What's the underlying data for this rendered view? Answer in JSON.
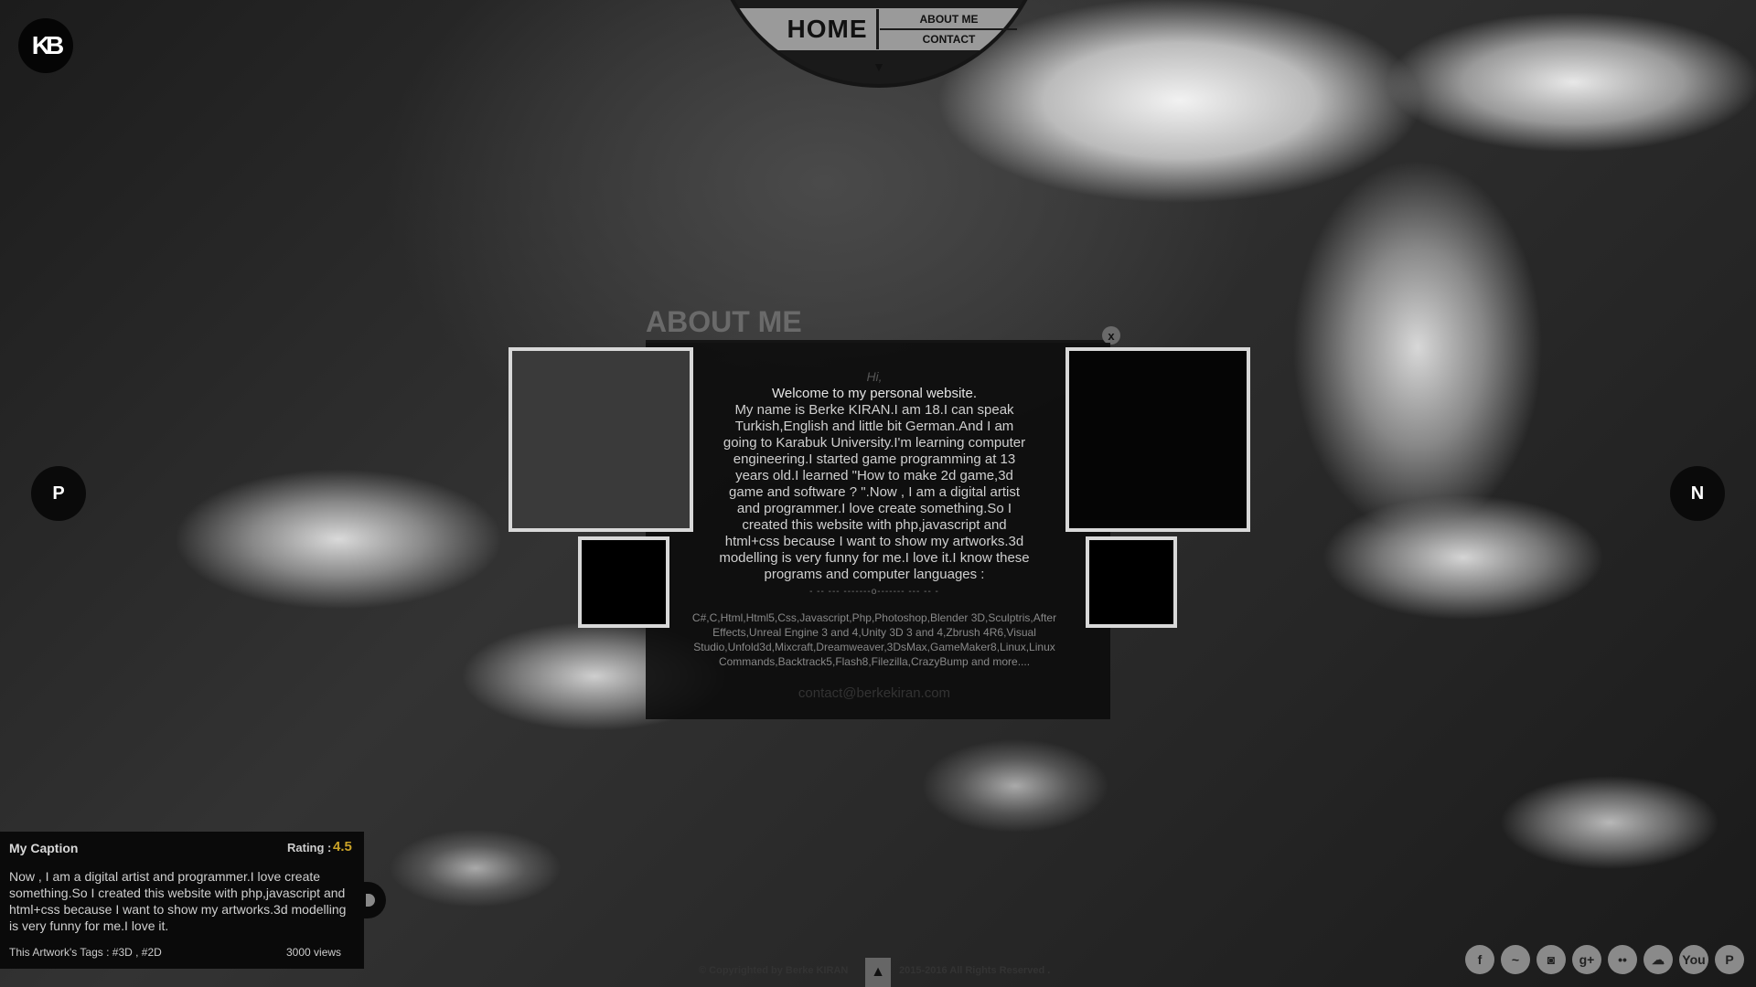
{
  "logo": {
    "text": "KB"
  },
  "nav": {
    "home": "HOME",
    "about": "ABOUT ME",
    "contact": "CONTACT",
    "arrow": "▼"
  },
  "pager": {
    "prev": "P",
    "next": "N"
  },
  "about": {
    "title": "ABOUT ME",
    "close": "x",
    "greeting": "Hi,",
    "welcome": "Welcome to my personal website.",
    "bio": "My name is Berke KIRAN.I am 18.I can speak Turkish,English and little bit German.And I am going to Karabuk University.I'm learning computer engineering.I started game programming at 13 years old.I learned \"How to make 2d game,3d game and software ? \".Now , I am a digital artist and programmer.I love create something.So I created this website with php,javascript and html+css because I want to show my artworks.3d modelling is very funny for me.I love it.I know these programs and computer languages :",
    "separator": "- -- --- -------o------- --- -- -",
    "languages": "C#,C,Html,Html5,Css,Javascript,Php,Photoshop,Blender 3D,Sculptris,After Effects,Unreal Engine 3 and 4,Unity 3D 3 and 4,Zbrush 4R6,Visual Studio,Unfold3d,Mixcraft,Dreamweaver,3DsMax,GameMaker8,Linux,Linux Commands,Backtrack5,Flash8,Filezilla,CrazyBump and more....",
    "email": "contact@berkekiran.com"
  },
  "caption": {
    "title": "My Caption",
    "rating_label": "Rating :",
    "rating_value": "4.5",
    "text": "Now , I am a digital artist and programmer.I love create something.So I created this website with php,javascript and html+css because I want to show my artworks.3d modelling is very funny for me.I love it.",
    "tags": "This Artwork's Tags : #3D , #2D",
    "views": "3000 views"
  },
  "footer": {
    "copyright": "© Copyrighted by Berke KIRAN",
    "rights": "2015-2016 All Rights Reserved .",
    "up_arrow": "▲"
  },
  "social": {
    "facebook": "f",
    "steam": "~",
    "instagram": "◙",
    "googleplus": "g+",
    "flickr": "••",
    "soundcloud": "☁",
    "youtube": "You",
    "paypal": "P"
  },
  "colors": {
    "rating_accent": "#c9a227"
  }
}
